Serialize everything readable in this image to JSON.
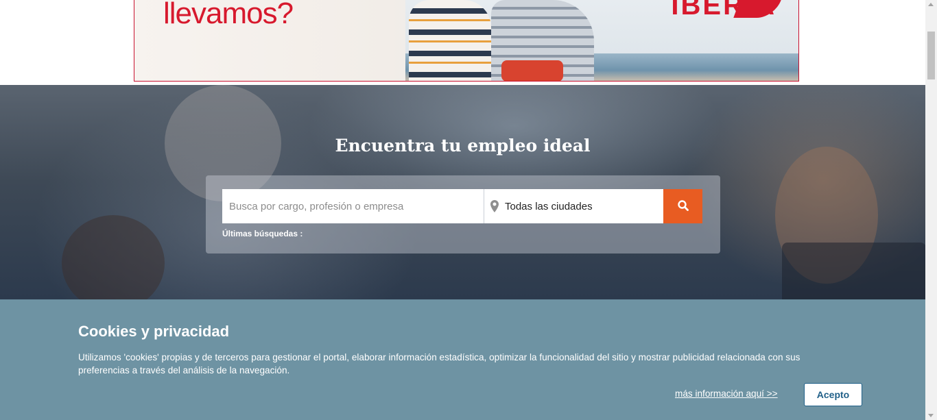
{
  "banner": {
    "headline": "llevamos?",
    "brand": "IBERIA"
  },
  "hero": {
    "title": "Encuentra tu empleo ideal",
    "search": {
      "placeholder": "Busca por cargo, profesión o empresa",
      "value": ""
    },
    "location": {
      "icon": "map-pin-icon",
      "value": "Todas las ciudades"
    },
    "search_button_icon": "search-icon",
    "recent_searches_label": "Últimas búsquedas :"
  },
  "cookies": {
    "title": "Cookies y privacidad",
    "text": "Utilizamos 'cookies' propias y de terceros para gestionar el portal, elaborar información estadística, optimizar la funcionalidad del sitio y mostrar publicidad relacionada con sus preferencias a través del análisis de la navegación.",
    "more_info_link": "más información aquí >>",
    "accept_button": "Acepto"
  },
  "colors": {
    "brand_red": "#d7192d",
    "search_orange": "#e85c22",
    "cookie_bg": "#6e93a3",
    "accept_text": "#1f5f88"
  }
}
